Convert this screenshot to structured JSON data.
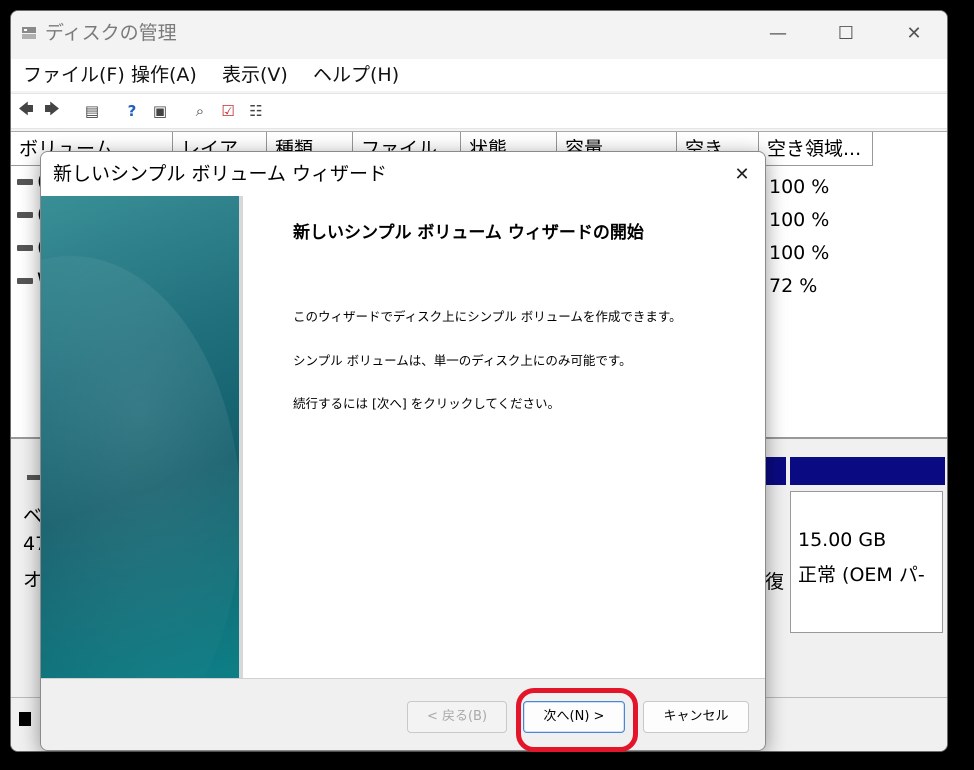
{
  "app": {
    "title": "ディスクの管理"
  },
  "menu": [
    "ファイル(F)",
    "操作(A)",
    "表示(V)",
    "ヘルプ(H)"
  ],
  "list": {
    "columns": [
      "ボリューム",
      "レイア",
      "種類",
      "ファイル",
      "状態",
      "容量",
      "空き",
      "空き領域..."
    ],
    "rows": [
      {
        "volume": "(",
        "free_pct": "100 %"
      },
      {
        "volume": "(",
        "free_pct": "100 %"
      },
      {
        "volume": "(",
        "free_pct": "100 %"
      },
      {
        "volume": "W",
        "free_pct": "72 %"
      }
    ]
  },
  "disk_pane": {
    "disk_label_partial": [
      "ベ",
      "47",
      "オ"
    ],
    "mid_partial": "復",
    "partition_size": "15.00 GB",
    "partition_status": "正常 (OEM パ-"
  },
  "wizard": {
    "title": "新しいシンプル ボリューム ウィザード",
    "heading": "新しいシンプル ボリューム ウィザードの開始",
    "paragraphs": [
      "このウィザードでディスク上にシンプル ボリュームを作成できます。",
      "シンプル ボリュームは、単一のディスク上にのみ可能です。",
      "続行するには [次へ] をクリックしてください。"
    ],
    "back_label": "< 戻る(B)",
    "next_label": "次へ(N) >",
    "cancel_label": "キャンセル"
  },
  "colors": {
    "highlight": "#e3152a",
    "disk_bar": "#0a0a82",
    "wizard_side": "#135e6b"
  }
}
